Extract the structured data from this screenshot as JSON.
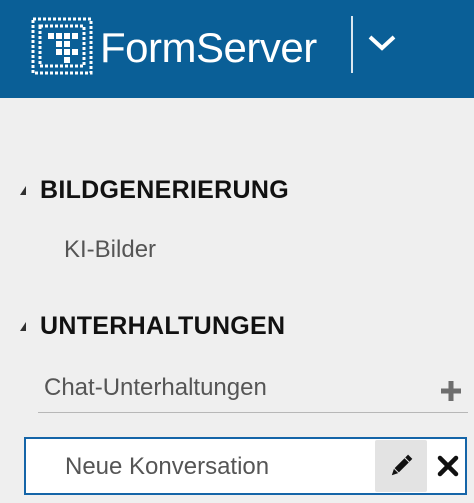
{
  "app": {
    "brand_name": "FormServer",
    "logo_icon": "formserver-logo-icon",
    "dropdown_icon": "chevron-down-icon",
    "header_color": "#0a5f97"
  },
  "sections": [
    {
      "title": "BILDGENERIERUNG",
      "icon": "collapse-triangle-icon",
      "items": [
        {
          "label": "KI-Bilder"
        }
      ]
    },
    {
      "title": "UNTERHALTUNGEN",
      "icon": "collapse-triangle-icon",
      "items": [
        {
          "label": "Chat-Unterhaltungen",
          "action_icon": "plus-icon"
        }
      ]
    }
  ],
  "conversation": {
    "label": "Neue Konversation",
    "edit_icon": "pencil-icon",
    "delete_icon": "close-icon",
    "accent_color": "#1565a8"
  }
}
